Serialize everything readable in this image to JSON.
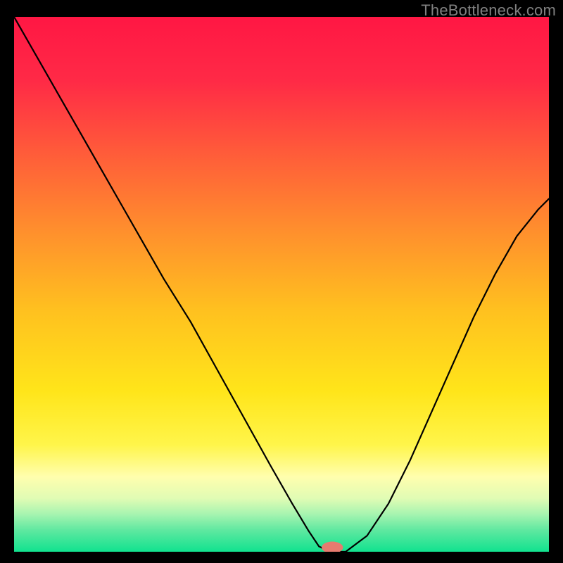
{
  "attribution": "TheBottleneck.com",
  "chart_data": {
    "type": "line",
    "title": "",
    "xlabel": "",
    "ylabel": "",
    "xlim": [
      0,
      100
    ],
    "ylim": [
      0,
      100
    ],
    "grid": false,
    "legend": false,
    "background_gradient_stops": [
      {
        "offset": 0,
        "color": "#ff1744"
      },
      {
        "offset": 12,
        "color": "#ff2a46"
      },
      {
        "offset": 25,
        "color": "#ff5a3a"
      },
      {
        "offset": 40,
        "color": "#ff8f2d"
      },
      {
        "offset": 55,
        "color": "#ffc11f"
      },
      {
        "offset": 70,
        "color": "#ffe51a"
      },
      {
        "offset": 80,
        "color": "#fff54a"
      },
      {
        "offset": 86,
        "color": "#fffeae"
      },
      {
        "offset": 90,
        "color": "#e1fcb4"
      },
      {
        "offset": 93,
        "color": "#a6f4b0"
      },
      {
        "offset": 96,
        "color": "#5ee8a0"
      },
      {
        "offset": 100,
        "color": "#11e28f"
      }
    ],
    "series": [
      {
        "name": "bottleneck-curve",
        "color": "#000000",
        "stroke_width": 2.2,
        "x": [
          0,
          4,
          8,
          12,
          16,
          20,
          24,
          28,
          33,
          38,
          43,
          48,
          52,
          55,
          57,
          59,
          62,
          66,
          70,
          74,
          78,
          82,
          86,
          90,
          94,
          98,
          100
        ],
        "y": [
          100,
          93,
          86,
          79,
          72,
          65,
          58,
          51,
          43,
          34,
          25,
          16,
          9,
          4,
          1,
          0,
          0,
          3,
          9,
          17,
          26,
          35,
          44,
          52,
          59,
          64,
          66
        ]
      }
    ],
    "marker": {
      "name": "optimal-marker",
      "x": 59.5,
      "y": 0.8,
      "rx": 2.0,
      "ry": 1.1,
      "fill": "#e77b6f"
    }
  }
}
